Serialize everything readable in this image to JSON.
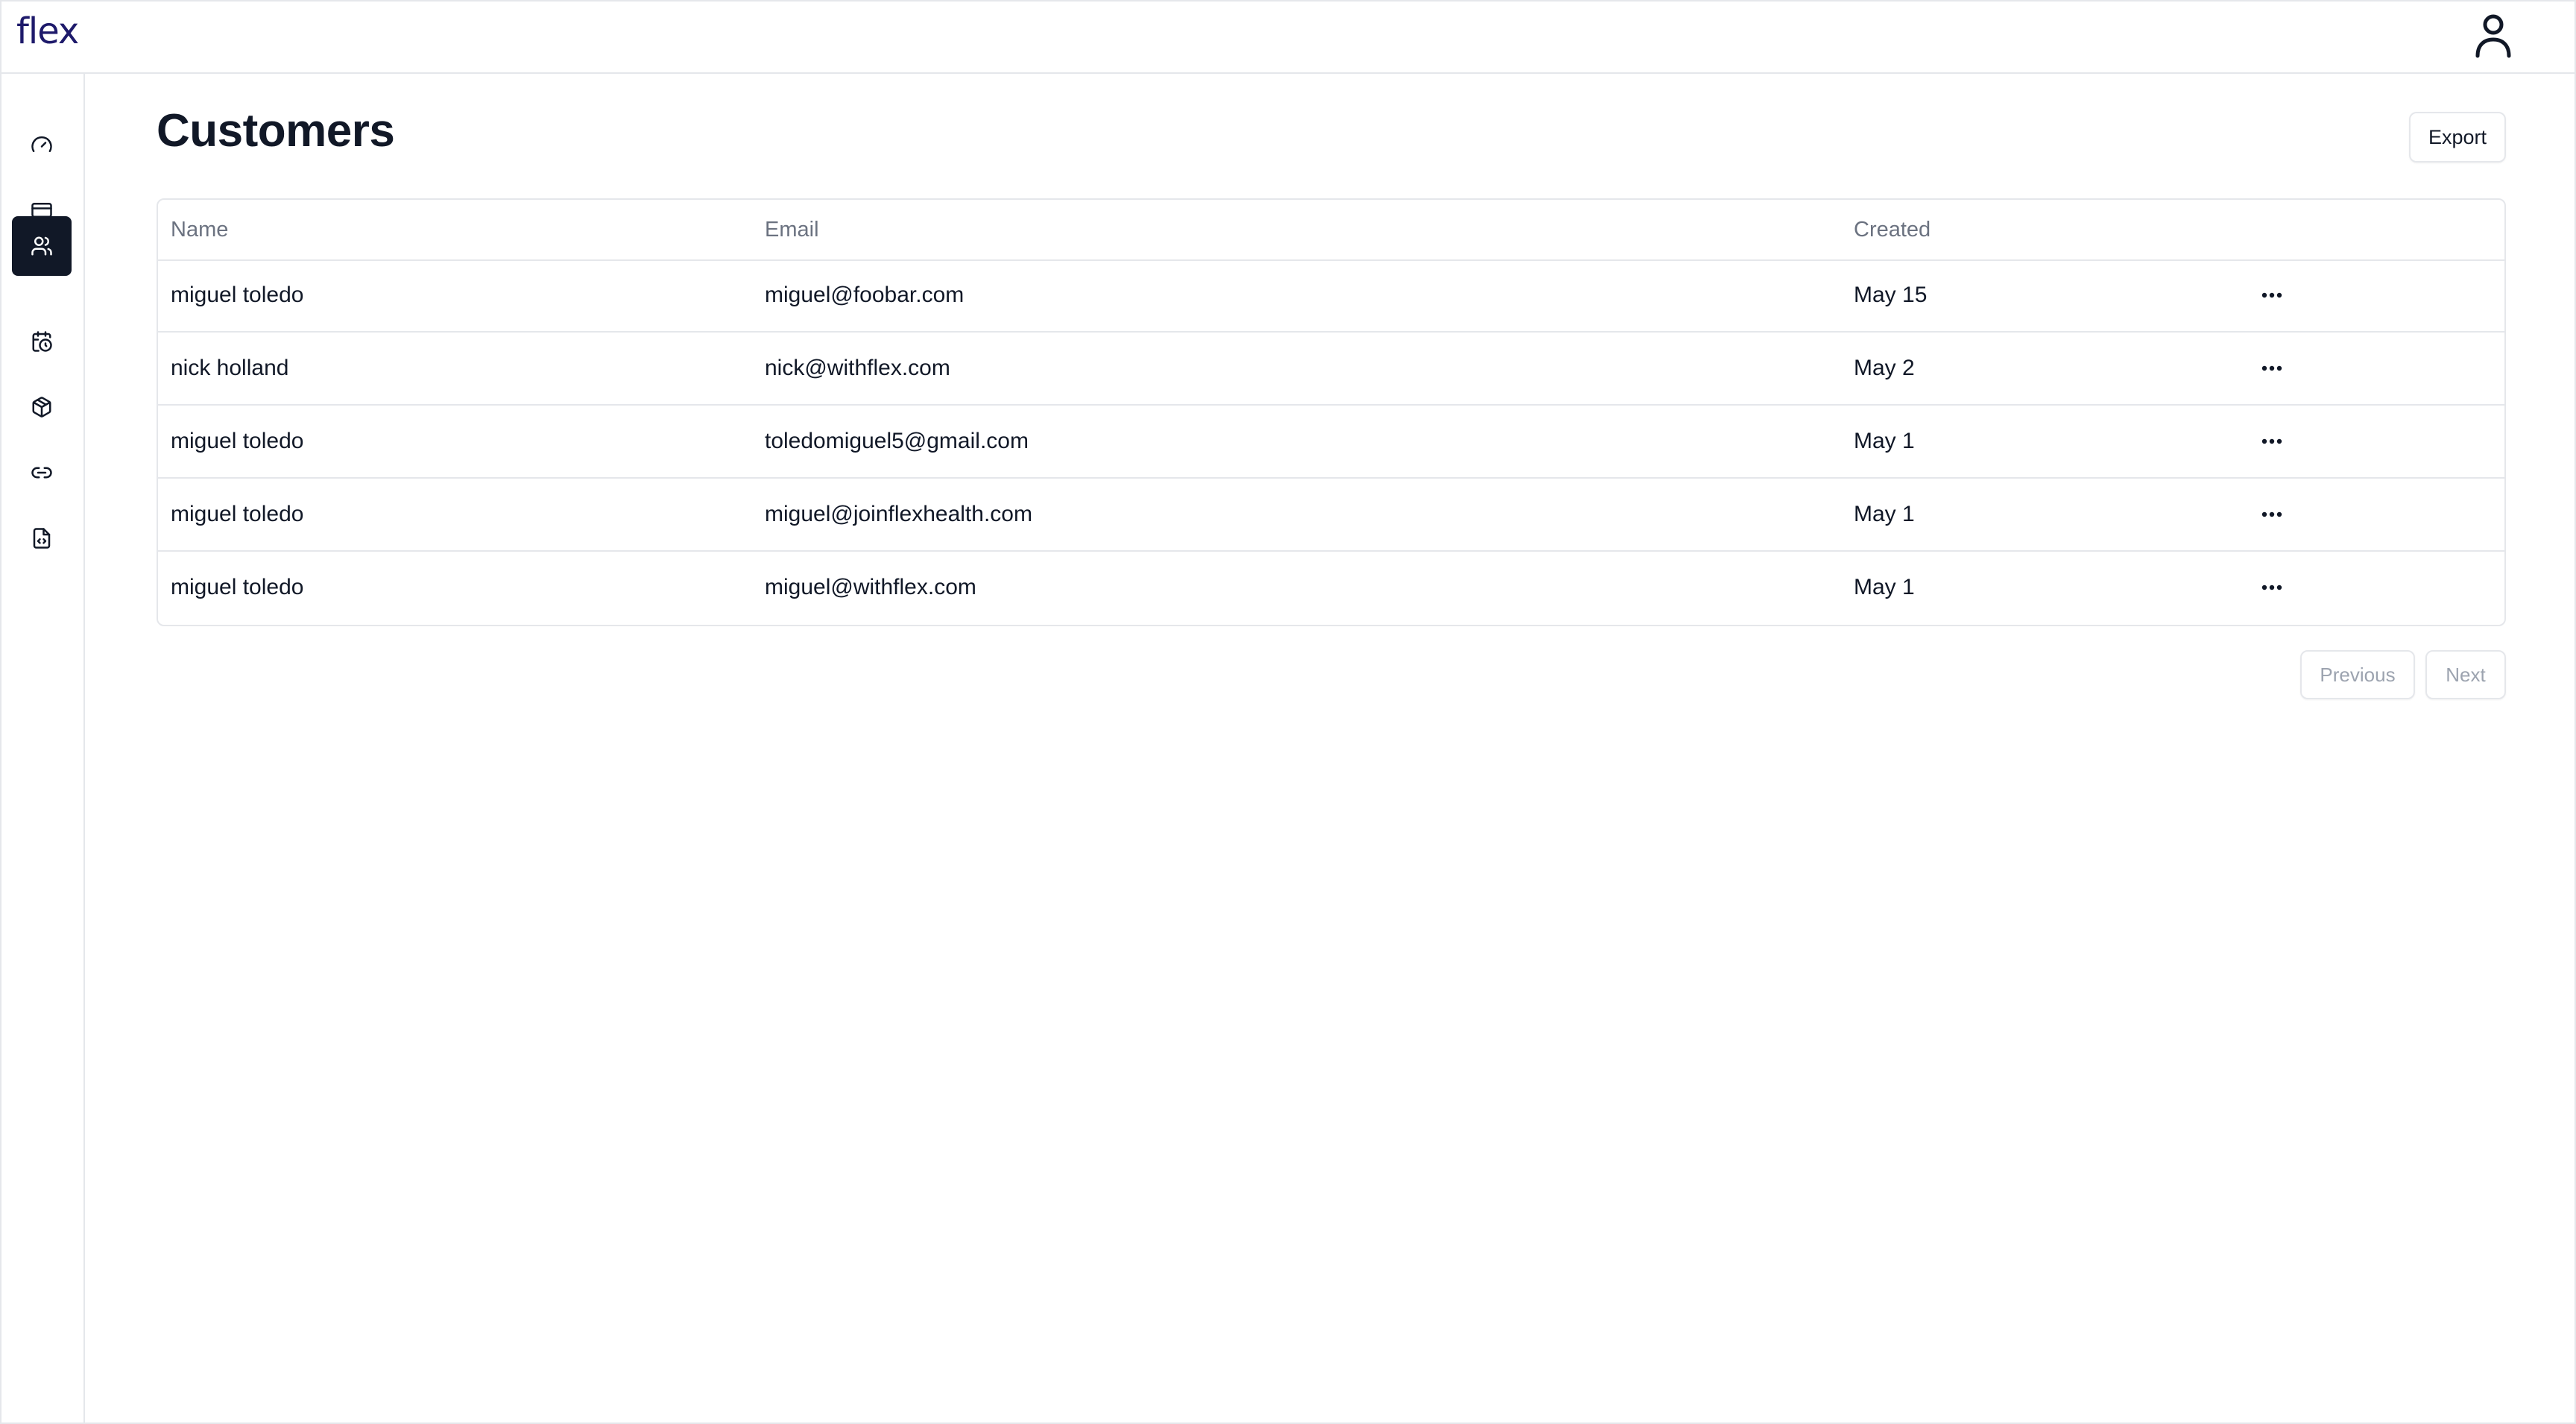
{
  "app": {
    "logo_text": "flex"
  },
  "header": {
    "user_icon": "user-icon"
  },
  "sidebar": {
    "items": [
      {
        "icon": "gauge-icon",
        "active": false
      },
      {
        "icon": "credit-card-icon",
        "active": false
      },
      {
        "icon": "users-icon",
        "active": true
      },
      {
        "icon": "calendar-clock-icon",
        "active": false
      },
      {
        "icon": "package-icon",
        "active": false
      },
      {
        "icon": "link-icon",
        "active": false
      },
      {
        "icon": "file-code-icon",
        "active": false
      }
    ]
  },
  "page": {
    "title": "Customers",
    "export_label": "Export"
  },
  "table": {
    "columns": [
      "Name",
      "Email",
      "Created"
    ],
    "rows": [
      {
        "name": "miguel toledo",
        "email": "miguel@foobar.com",
        "created": "May 15"
      },
      {
        "name": "nick holland",
        "email": "nick@withflex.com",
        "created": "May 2"
      },
      {
        "name": "miguel toledo",
        "email": "toledomiguel5@gmail.com",
        "created": "May 1"
      },
      {
        "name": "miguel toledo",
        "email": "miguel@joinflexhealth.com",
        "created": "May 1"
      },
      {
        "name": "miguel toledo",
        "email": "miguel@withflex.com",
        "created": "May 1"
      }
    ]
  },
  "pagination": {
    "previous_label": "Previous",
    "next_label": "Next"
  },
  "colors": {
    "primary": "#111827",
    "logo": "#1e1a6b",
    "border": "#e5e7eb",
    "muted": "#6b7280"
  }
}
